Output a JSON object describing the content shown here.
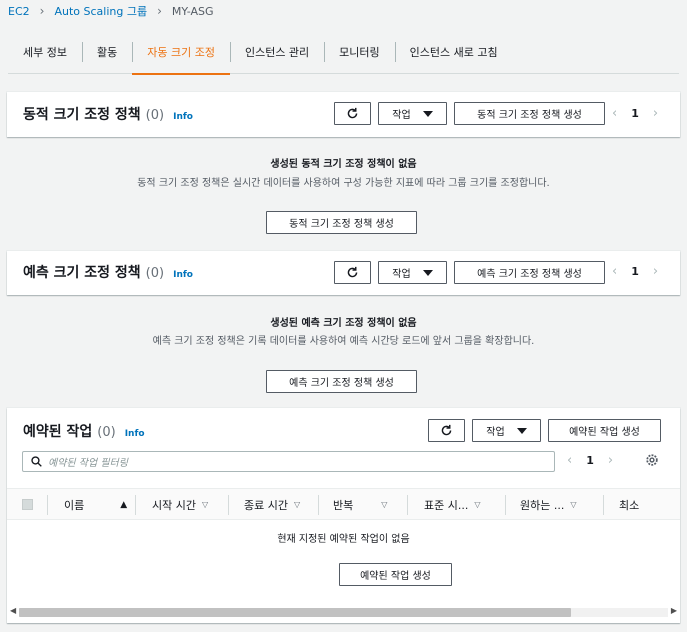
{
  "breadcrumb": {
    "ec2": "EC2",
    "asg": "Auto Scaling 그룹",
    "current": "MY-ASG"
  },
  "tabs": [
    "세부 정보",
    "활동",
    "자동 크기 조정",
    "인스턴스 관리",
    "모니터링",
    "인스턴스 새로 고침"
  ],
  "active_tab": "자동 크기 조정",
  "dynamic": {
    "title": "동적 크기 조정 정책",
    "count": "(0)",
    "info": "Info",
    "actions": "작업",
    "create": "동적 크기 조정 정책 생성",
    "page": "1",
    "empty_title": "생성된 동적 크기 조정 정책이 없음",
    "empty_desc": "동적 크기 조정 정책은 실시간 데이터를 사용하여 구성 가능한 지표에 따라 그룹 크기를 조정합니다.",
    "empty_button": "동적 크기 조정 정책 생성"
  },
  "predictive": {
    "title": "예측 크기 조정 정책",
    "count": "(0)",
    "info": "Info",
    "actions": "작업",
    "create": "예측 크기 조정 정책 생성",
    "page": "1",
    "empty_title": "생성된 예측 크기 조정 정책이 없음",
    "empty_desc": "예측 크기 조정 정책은 기록 데이터를 사용하여 예측 시간당 로드에 앞서 그룹을 확장합니다.",
    "empty_button": "예측 크기 조정 정책 생성"
  },
  "scheduled": {
    "title": "예약된 작업",
    "count": "(0)",
    "info": "Info",
    "actions": "작업",
    "create": "예약된 작업 생성",
    "filter_placeholder": "예약된 작업 필터링",
    "page": "1",
    "columns": [
      "이름",
      "시작 시간",
      "종료 시간",
      "반복",
      "표준 시...",
      "원하는 ...",
      "최소"
    ],
    "empty_title": "현재 지정된 예약된 작업이 없음",
    "empty_button": "예약된 작업 생성"
  },
  "colors": {
    "link": "#0073bb",
    "accent": "#ec7211",
    "border": "#545b64"
  }
}
